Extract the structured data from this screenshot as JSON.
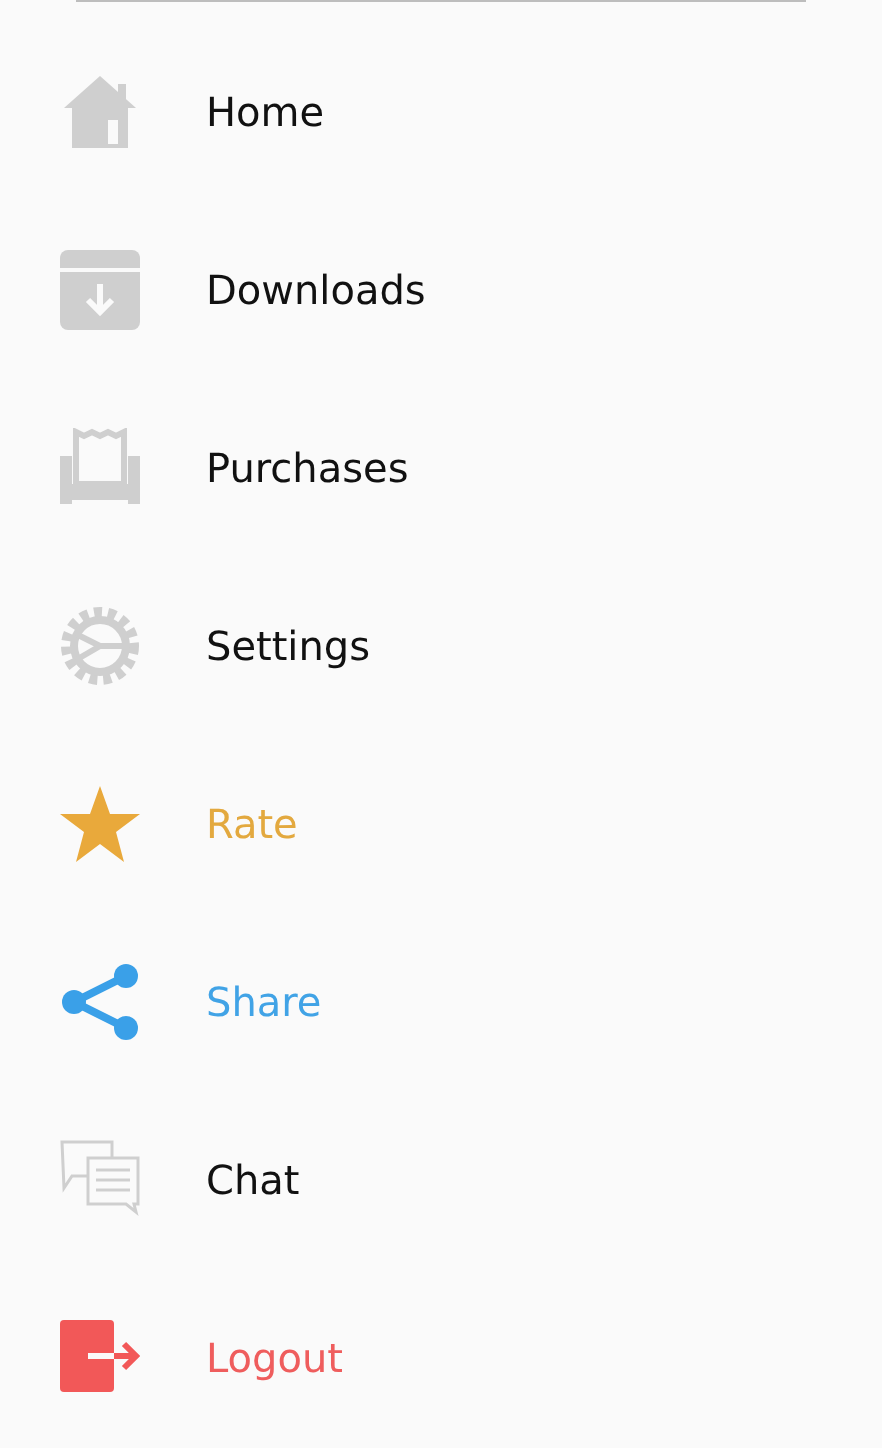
{
  "menu": {
    "items": [
      {
        "kind": "home",
        "label": "Home",
        "color": "#111111"
      },
      {
        "kind": "downloads",
        "label": "Downloads",
        "color": "#111111"
      },
      {
        "kind": "purchases",
        "label": "Purchases",
        "color": "#111111"
      },
      {
        "kind": "settings",
        "label": "Settings",
        "color": "#111111"
      },
      {
        "kind": "rate",
        "label": "Rate",
        "color": "#e3a93f"
      },
      {
        "kind": "share",
        "label": "Share",
        "color": "#41a3e6"
      },
      {
        "kind": "chat",
        "label": "Chat",
        "color": "#111111"
      },
      {
        "kind": "logout",
        "label": "Logout",
        "color": "#ef5d5d"
      }
    ]
  }
}
